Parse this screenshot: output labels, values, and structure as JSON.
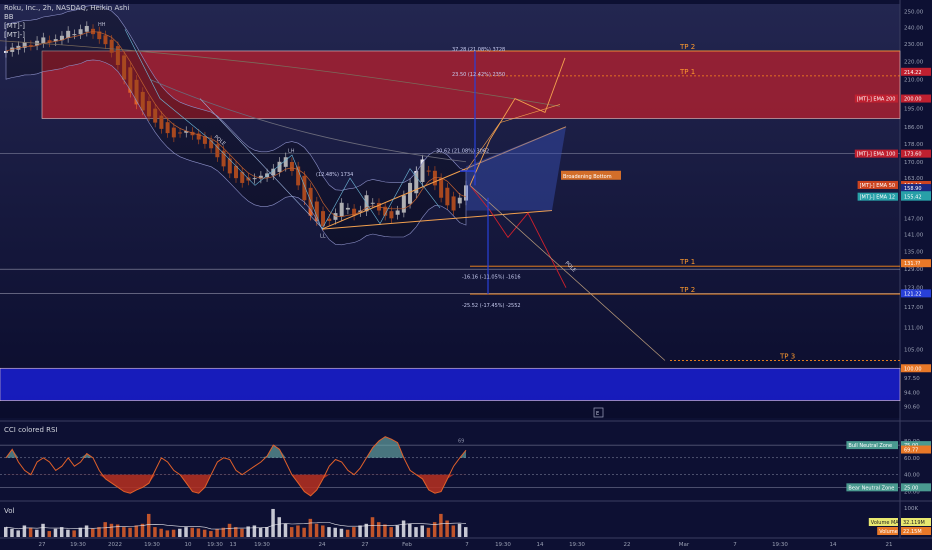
{
  "legend": {
    "symbol": "Roku, Inc., 2h, NASDAQ, Heikin Ashi",
    "bb": "BB",
    "mt1": "[MT]-]",
    "mt2": "[MT]-]"
  },
  "colors": {
    "background": "#0d1033",
    "bullish": "#e8e8ee",
    "bearish": "#e0602a",
    "resistance_zone": "#b3202e",
    "support_zone": "#1a1fd4",
    "fib_line": "#ff8c1a",
    "pattern": "#f3a04e",
    "pole": "#9fb7e0"
  },
  "chart_data": [
    {
      "type": "candlestick",
      "title": "Roku, Inc., 2h, NASDAQ, Heikin Ashi",
      "scale": "log",
      "ylim": [
        88,
        255
      ],
      "y_ticks": [
        "250.00",
        "240.00",
        "230.00",
        "220.00",
        "210.00",
        "200.00",
        "195.00",
        "186.00",
        "178.00",
        "170.00",
        "163.00",
        "156.00",
        "147.00",
        "141.00",
        "135.00",
        "129.00",
        "123.00",
        "117.00",
        "111.00",
        "105.00",
        "100.00",
        "97.50",
        "94.00",
        "90.60"
      ],
      "closes": [
        226,
        228,
        229,
        231,
        229,
        232,
        234,
        231,
        233,
        235,
        238,
        236,
        239,
        241,
        236,
        233,
        230,
        225,
        218,
        210,
        203,
        197,
        194,
        191,
        188,
        185,
        183,
        181,
        183,
        184,
        182,
        180,
        178,
        176,
        172,
        168,
        165,
        163,
        161,
        162,
        163,
        164,
        165,
        167,
        170,
        172,
        166,
        160,
        154,
        148,
        146,
        144,
        146,
        149,
        153,
        151,
        148,
        150,
        156,
        153,
        150,
        148,
        147,
        150,
        156,
        161,
        166,
        171,
        166,
        160,
        155,
        152,
        150,
        155,
        160
      ],
      "x_tick_labels": [
        "27",
        "19:30",
        "2022",
        "19:30",
        "10",
        "19:30",
        "13",
        "19:30",
        "24",
        "27",
        "Feb",
        "7",
        "19:30",
        "14",
        "19:30",
        "22",
        "Mar",
        "7",
        "19:30",
        "14",
        "21"
      ],
      "x_tick_positions_note": "",
      "ema_labels": [
        {
          "name": "[MT]-] EMA 200",
          "value": "200.00"
        },
        {
          "name": "[MT]-] EMA 100",
          "value": "173.60"
        },
        {
          "name": "[MT]-] EMA 50",
          "value": "160.17"
        },
        {
          "name": "",
          "value": "158.90"
        },
        {
          "name": "",
          "value": "156.??"
        },
        {
          "name": "[MT]-] EMA 12",
          "value": "155.42"
        },
        {
          "name": "",
          "value": "131.??"
        },
        {
          "name": "",
          "value": "121.22"
        },
        {
          "name": "",
          "value": "100.00"
        }
      ],
      "price_tags": [
        "214.22",
        "200.00",
        "173.60",
        "160.17",
        "158.90",
        "156.??",
        "155.42",
        "131.??",
        "121.22",
        "100.00"
      ],
      "zones": [
        {
          "name": "resistance",
          "from": 190,
          "to": 226
        },
        {
          "name": "support",
          "from": 92,
          "to": 100
        }
      ],
      "levels": [
        {
          "label": "TP 2",
          "value": 226
        },
        {
          "label": "TP 1",
          "value": 212
        },
        {
          "label": "TP 1",
          "value": 130
        },
        {
          "label": "TP 2",
          "value": 121
        },
        {
          "label": "TP 3",
          "value": 102
        }
      ],
      "annotations": [
        {
          "text": "HH",
          "value": 241
        },
        {
          "text": "LH",
          "value": 174
        },
        {
          "text": "LL",
          "value": 140
        },
        {
          "text": "POLE",
          "value": 181
        },
        {
          "text": "POLE",
          "value": 131
        },
        {
          "text": "Broadening Bottom",
          "value": 164
        },
        {
          "text": "37.28 (21.08%) 3728",
          "value": 226
        },
        {
          "text": "23.50 (12.42%) 2350",
          "value": 212
        },
        {
          "text": "30.62 (21.08%) 3062",
          "value": 174
        },
        {
          "text": "(12.48%) 1734",
          "value": 164
        },
        {
          "text": "-16.16 (-11.05%) -1616",
          "value": 126
        },
        {
          "text": "-25.52 (-17.45%) -2552",
          "value": 117
        }
      ],
      "marker": "E"
    },
    {
      "type": "line",
      "title": "CCI colored RSI",
      "ylim": [
        10,
        100
      ],
      "y_ticks": [
        "80.00",
        "60.00",
        "40.00",
        "20.00"
      ],
      "values": [
        60,
        70,
        55,
        45,
        40,
        55,
        60,
        55,
        45,
        50,
        60,
        50,
        55,
        65,
        60,
        45,
        35,
        30,
        25,
        20,
        18,
        22,
        25,
        30,
        45,
        60,
        55,
        45,
        40,
        30,
        20,
        18,
        25,
        40,
        55,
        60,
        58,
        45,
        40,
        45,
        50,
        55,
        62,
        75,
        70,
        55,
        40,
        30,
        20,
        15,
        22,
        35,
        50,
        58,
        55,
        45,
        40,
        48,
        60,
        72,
        80,
        85,
        82,
        78,
        60,
        45,
        40,
        35,
        22,
        18,
        20,
        35,
        50,
        60,
        69
      ],
      "last_value": "69",
      "tags": [
        {
          "name": "Bull Neutral Zone",
          "value": "75.00"
        },
        {
          "name": "",
          "value": "69.77"
        },
        {
          "name": "Bear Neutral Zone",
          "value": "25.00"
        }
      ]
    },
    {
      "type": "bar",
      "title": "Vol",
      "y_ticks": [
        "100K",
        "50K"
      ],
      "values": [
        30,
        25,
        20,
        35,
        28,
        22,
        40,
        18,
        25,
        30,
        22,
        20,
        28,
        35,
        25,
        30,
        45,
        40,
        38,
        30,
        28,
        35,
        40,
        70,
        30,
        25,
        20,
        22,
        25,
        30,
        28,
        26,
        22,
        18,
        24,
        28,
        40,
        30,
        25,
        32,
        35,
        28,
        30,
        85,
        60,
        40,
        30,
        35,
        28,
        55,
        40,
        35,
        30,
        28,
        25,
        22,
        30,
        35,
        40,
        60,
        45,
        38,
        30,
        35,
        50,
        40,
        30,
        35,
        28,
        45,
        70,
        50,
        35,
        40,
        30
      ],
      "tags": [
        {
          "name": "Volume MA",
          "value": "32.119M"
        },
        {
          "name": "Volume",
          "value": "22.15M"
        }
      ]
    }
  ]
}
